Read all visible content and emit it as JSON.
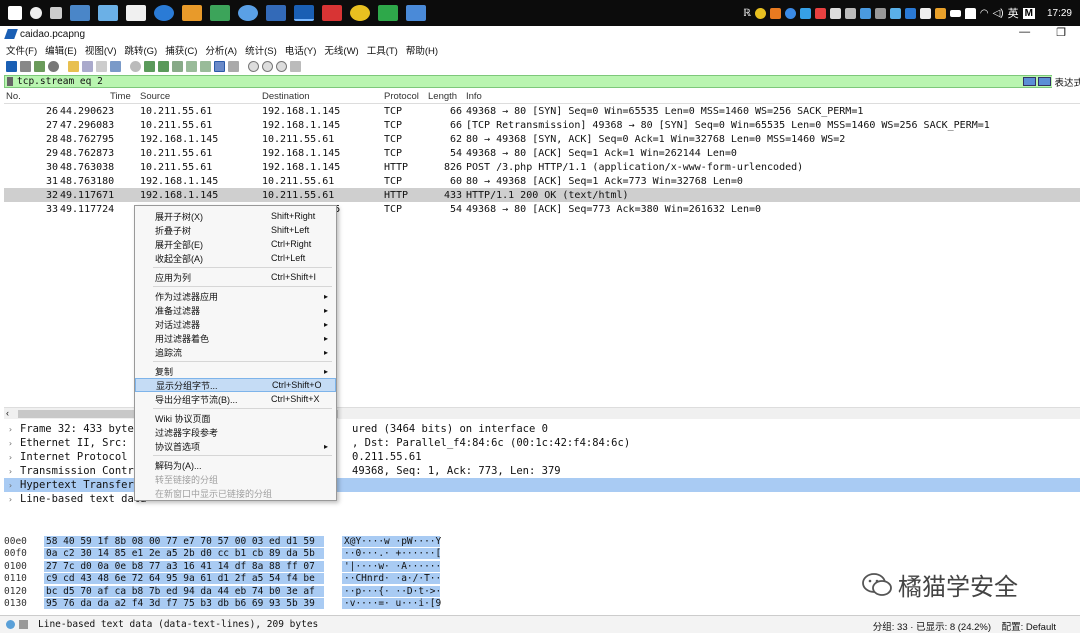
{
  "taskbar": {
    "clock": "17:29",
    "ime": "英",
    "ime_letter": "M"
  },
  "window": {
    "title": "caidao.pcapng",
    "minimize": "—",
    "restore": "❐"
  },
  "menubar": [
    "文件(F)",
    "编辑(E)",
    "视图(V)",
    "跳转(G)",
    "捕获(C)",
    "分析(A)",
    "统计(S)",
    "电话(Y)",
    "无线(W)",
    "工具(T)",
    "帮助(H)"
  ],
  "filter": {
    "value": "tcp.stream eq 2",
    "expression": "表达式"
  },
  "packet_list": {
    "headers": [
      "No.",
      "Time",
      "Source",
      "Destination",
      "Protocol",
      "Length",
      "Info"
    ],
    "rows": [
      {
        "no": "26",
        "time": "44.290623",
        "src": "10.211.55.61",
        "dst": "192.168.1.145",
        "proto": "TCP",
        "len": "66",
        "info": "49368 → 80 [SYN] Seq=0 Win=65535 Len=0 MSS=1460 WS=256 SACK_PERM=1"
      },
      {
        "no": "27",
        "time": "47.296083",
        "src": "10.211.55.61",
        "dst": "192.168.1.145",
        "proto": "TCP",
        "len": "66",
        "info": "[TCP Retransmission] 49368 → 80 [SYN] Seq=0 Win=65535 Len=0 MSS=1460 WS=256 SACK_PERM=1"
      },
      {
        "no": "28",
        "time": "48.762795",
        "src": "192.168.1.145",
        "dst": "10.211.55.61",
        "proto": "TCP",
        "len": "62",
        "info": "80 → 49368 [SYN, ACK] Seq=0 Ack=1 Win=32768 Len=0 MSS=1460 WS=2"
      },
      {
        "no": "29",
        "time": "48.762873",
        "src": "10.211.55.61",
        "dst": "192.168.1.145",
        "proto": "TCP",
        "len": "54",
        "info": "49368 → 80 [ACK] Seq=1 Ack=1 Win=262144 Len=0"
      },
      {
        "no": "30",
        "time": "48.763038",
        "src": "10.211.55.61",
        "dst": "192.168.1.145",
        "proto": "HTTP",
        "len": "826",
        "info": "POST /3.php HTTP/1.1  (application/x-www-form-urlencoded)"
      },
      {
        "no": "31",
        "time": "48.763180",
        "src": "192.168.1.145",
        "dst": "10.211.55.61",
        "proto": "TCP",
        "len": "60",
        "info": "80 → 49368 [ACK] Seq=1 Ack=773 Win=32768 Len=0"
      },
      {
        "no": "32",
        "time": "49.117671",
        "src": "192.168.1.145",
        "dst": "10.211.55.61",
        "proto": "HTTP",
        "len": "433",
        "info": "HTTP/1.1 200 OK  (text/html)"
      },
      {
        "no": "33",
        "time": "49.117724",
        "src": "10.211.55.61",
        "dst": "192.168.1.145",
        "proto": "TCP",
        "len": "54",
        "info": "49368 → 80 [ACK] Seq=773 Ack=380 Win=261632 Len=0"
      }
    ]
  },
  "details": [
    {
      "left": "Frame 32: 433 bytes",
      "right": "ured (3464 bits) on interface 0"
    },
    {
      "left": "Ethernet II, Src: Pa",
      "right": ", Dst: Parallel_f4:84:6c (00:1c:42:f4:84:6c)"
    },
    {
      "left": "Internet Protocol Ve",
      "right": "0.211.55.61"
    },
    {
      "left": "Transmission Control",
      "right": "49368, Seq: 1, Ack: 773, Len: 379"
    },
    {
      "left": "Hypertext Transfer P",
      "right": ""
    },
    {
      "left": "Line-based text data",
      "right": ""
    }
  ],
  "hex_rows": [
    {
      "off": "00e0",
      "bytes": "58 40 59 1f 8b 08 00 77  e7 70 57 00 03 ed d1 59",
      "ascii": "X@Y····w ·pW····Y"
    },
    {
      "off": "00f0",
      "bytes": "0a c2 30 14 85 e1 2e a5  2b d0 cc b1 cb 89 da 5b",
      "ascii": "··0···.· +······["
    },
    {
      "off": "0100",
      "bytes": "27 7c d0 0a 0e b8 77 a3  16 41 14 df 8a 88 ff 07",
      "ascii": "'|····w· ·A······"
    },
    {
      "off": "0110",
      "bytes": "c9 cd 43 48 6e 72 64 95  9a 61 d1 2f a5 54 f4 be",
      "ascii": "··CHnrd· ·a·/·T··"
    },
    {
      "off": "0120",
      "bytes": "bc d5 70 af ca b8 7b ed  94 da 44 eb 74 b0 3e af",
      "ascii": "··p···{· ··D·t·>·"
    },
    {
      "off": "0130",
      "bytes": "95 76 da da a2 f4 3d f7  75 b3 db b6 69 93 5b 39",
      "ascii": "·v····=· u···i·[9"
    }
  ],
  "status": {
    "text": "Line-based text data (data-text-lines), 209 bytes",
    "right": "分组: 33 · 已显示: 8 (24.2%)",
    "profile": "配置: Default"
  },
  "context_menu": {
    "groups": [
      [
        {
          "label": "展开子树(X)",
          "shortcut": "Shift+Right"
        },
        {
          "label": "折叠子树",
          "shortcut": "Shift+Left"
        },
        {
          "label": "展开全部(E)",
          "shortcut": "Ctrl+Right"
        },
        {
          "label": "收起全部(A)",
          "shortcut": "Ctrl+Left"
        }
      ],
      [
        {
          "label": "应用为列",
          "shortcut": "Ctrl+Shift+I"
        }
      ],
      [
        {
          "label": "作为过滤器应用",
          "submenu": true
        },
        {
          "label": "准备过滤器",
          "submenu": true
        },
        {
          "label": "对话过滤器",
          "submenu": true
        },
        {
          "label": "用过滤器着色",
          "submenu": true
        },
        {
          "label": "追踪流",
          "submenu": true
        }
      ],
      [
        {
          "label": "复制",
          "submenu": true
        },
        {
          "label": "显示分组字节...",
          "shortcut": "Ctrl+Shift+O",
          "hot": true
        },
        {
          "label": "导出分组字节流(B)...",
          "shortcut": "Ctrl+Shift+X"
        }
      ],
      [
        {
          "label": "Wiki 协议页面"
        },
        {
          "label": "过滤器字段参考"
        },
        {
          "label": "协议首选项",
          "submenu": true
        }
      ],
      [
        {
          "label": "解码为(A)..."
        },
        {
          "label": "转至链接的分组",
          "disabled": true
        },
        {
          "label": "在新窗口中显示已链接的分组",
          "disabled": true
        }
      ]
    ]
  },
  "watermark": {
    "text": "橘猫学安全"
  },
  "colors": {
    "filter_bg": "#b9f5b0",
    "selection": "#a9cbf3",
    "menu_hot": "#c5dcf5"
  }
}
